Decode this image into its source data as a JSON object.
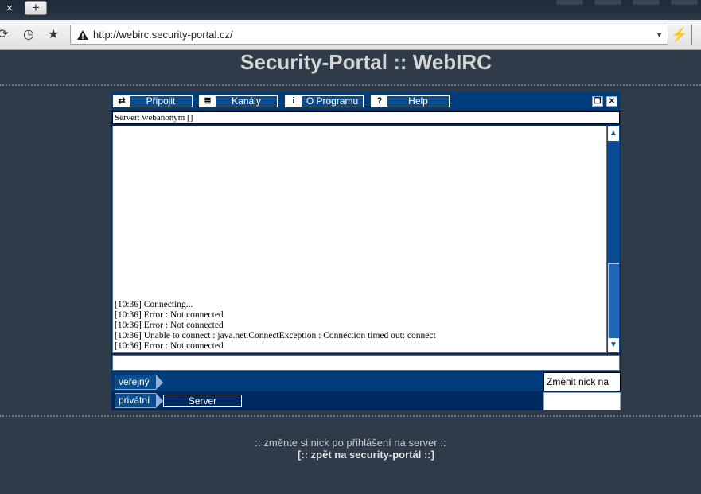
{
  "browser": {
    "tab_close_glyph": "×",
    "new_tab_glyph": "+",
    "url": "http://webirc.security-portal.cz/",
    "url_dropdown_glyph": "▼",
    "bolt_glyph": "⚡"
  },
  "page": {
    "title": "Security-Portal :: WebIRC",
    "footer_note": ":: změnte si nick po přihlášení na server ::",
    "footer_link": "[:: zpět na security-portál ::]"
  },
  "applet": {
    "toolbar": [
      {
        "label": "Připojit",
        "icon": "connect-arrows-icon"
      },
      {
        "label": "Kanály",
        "icon": "channel-list-icon"
      },
      {
        "label": "O Programu",
        "icon": "info-icon"
      },
      {
        "label": "Help",
        "icon": "question-icon"
      }
    ],
    "icons": {
      "connect": "⇄",
      "channels": "≣",
      "info": "i",
      "help": "?"
    },
    "window_controls": {
      "restore": "❐",
      "close": "✕"
    },
    "server_line": "Server: webanonym []",
    "chat_lines": [
      "[10:36] Connecting...",
      "[10:36] Error : Not connected",
      "[10:36] Error : Not connected",
      "[10:36] Unable to connect : java.net.ConnectException : Connection timed out: connect",
      "[10:36] Error : Not connected"
    ],
    "scroll": {
      "up": "▲",
      "down": "▼"
    },
    "bottom": {
      "public_label": "veřejný",
      "private_label": "privátní",
      "server_tab": "Server",
      "nick_label": "Změnit nick na",
      "nick_value": ""
    }
  }
}
